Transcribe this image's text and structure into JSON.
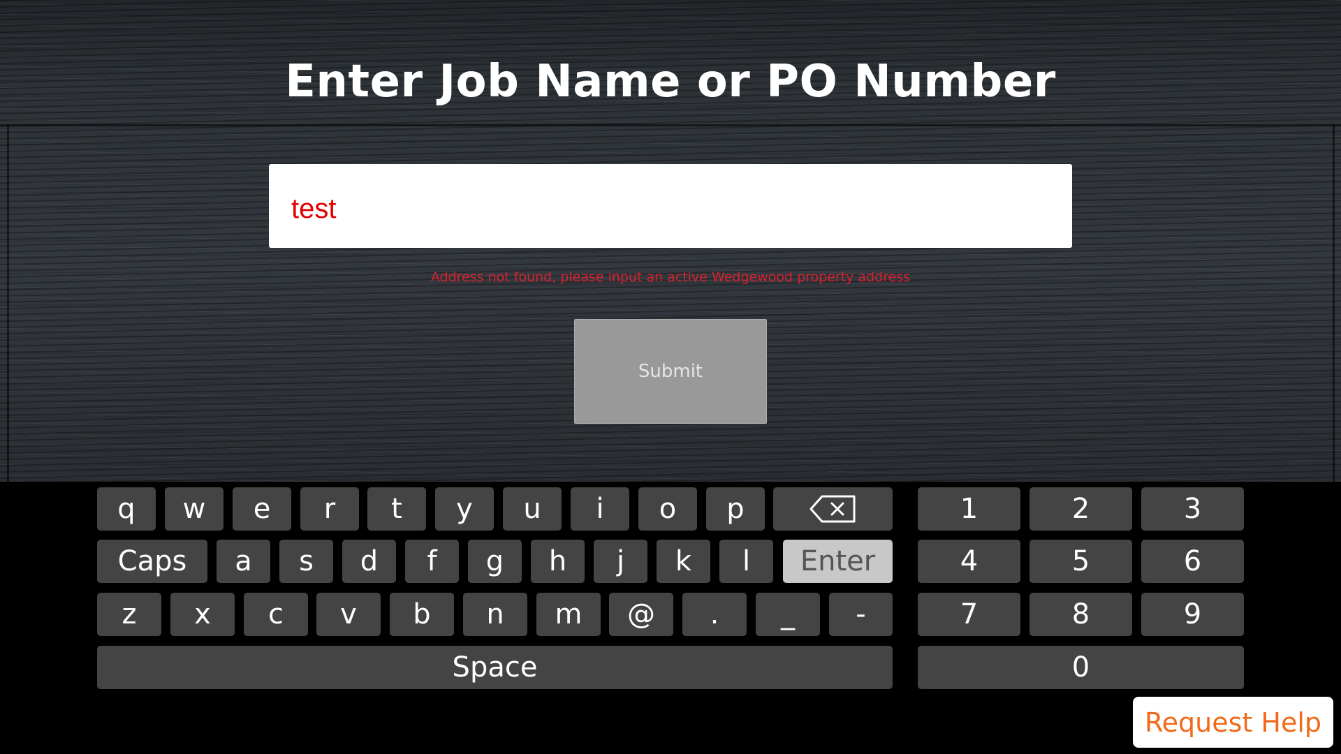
{
  "page": {
    "title": "Enter Job Name or PO Number",
    "error": "Address not found, please input an active Wedgewood property address"
  },
  "input": {
    "value": "test",
    "placeholder": ""
  },
  "submit": {
    "label": "Submit"
  },
  "keyboard": {
    "row1": [
      "q",
      "w",
      "e",
      "r",
      "t",
      "y",
      "u",
      "i",
      "o",
      "p"
    ],
    "backspace_icon": "backspace-icon",
    "row2": [
      "a",
      "s",
      "d",
      "f",
      "g",
      "h",
      "j",
      "k",
      "l"
    ],
    "caps": "Caps",
    "enter": "Enter",
    "row3": [
      "z",
      "x",
      "c",
      "v",
      "b",
      "n",
      "m",
      "@",
      ".",
      "_",
      "-"
    ],
    "space": "Space",
    "numpad": [
      "1",
      "2",
      "3",
      "4",
      "5",
      "6",
      "7",
      "8",
      "9"
    ],
    "zero": "0"
  },
  "help": {
    "label": "Request Help"
  },
  "colors": {
    "input_text": "#e20000",
    "error_text": "#d9212e",
    "help_text": "#f06a1a",
    "key_bg": "#444444",
    "enter_bg": "#c8c8c8"
  }
}
